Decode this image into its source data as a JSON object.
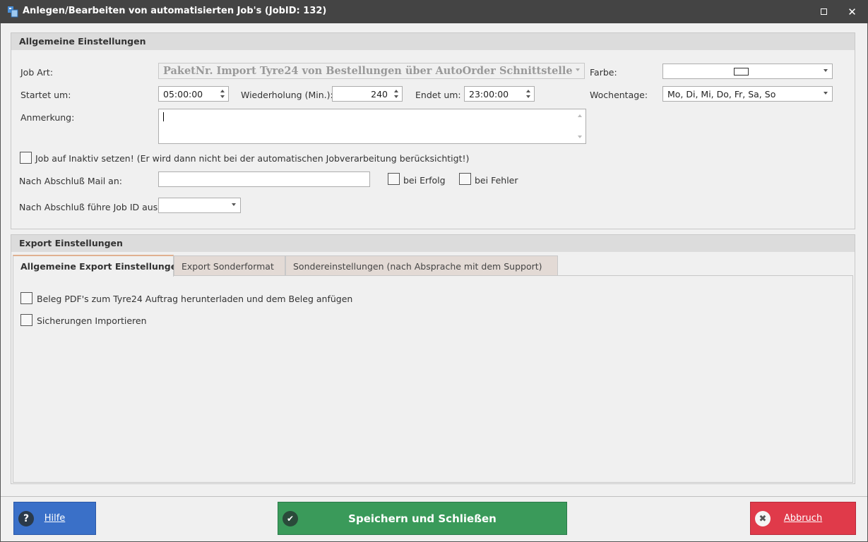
{
  "window": {
    "title": "Anlegen/Bearbeiten von automatisierten Job's (JobID: 132)",
    "icon": "app-icon"
  },
  "general": {
    "header": "Allgemeine Einstellungen",
    "job_art_label": "Job Art:",
    "job_art_value": "PaketNr. Import Tyre24 von Bestellungen über AutoOrder Schnittstelle",
    "farbe_label": "Farbe:",
    "startet_label": "Startet um:",
    "startet_value": "05:00:00",
    "wiederholung_label": "Wiederholung (Min.):",
    "wiederholung_value": "240",
    "endet_label": "Endet um:",
    "endet_value": "23:00:00",
    "wochentage_label": "Wochentage:",
    "wochentage_value": "Mo, Di, Mi, Do, Fr, Sa, So",
    "anmerkung_label": "Anmerkung:",
    "anmerkung_value": "",
    "inaktiv_label": "Job auf Inaktiv setzen! (Er wird dann nicht bei der automatischen Jobverarbeitung berücksichtigt!)",
    "mail_label": "Nach Abschluß Mail an:",
    "mail_value": "",
    "bei_erfolg_label": "bei Erfolg",
    "bei_fehler_label": "bei Fehler",
    "fuehre_label": "Nach Abschluß führe Job ID aus:",
    "fuehre_value": ""
  },
  "export": {
    "header": "Export Einstellungen",
    "tabs": [
      {
        "label": "Allgemeine Export Einstellungen",
        "active": true
      },
      {
        "label": "Export Sonderformat",
        "active": false
      },
      {
        "label": "Sondereinstellungen (nach Absprache mit dem Support)",
        "active": false
      }
    ],
    "options": [
      {
        "label": "Beleg PDF's zum Tyre24 Auftrag herunterladen und dem Beleg anfügen",
        "checked": false
      },
      {
        "label": "Sicherungen Importieren",
        "checked": false
      }
    ]
  },
  "footer": {
    "hilfe_label": "Hilfe",
    "save_label": "Speichern und Schließen",
    "abbruch_label": "Abbruch",
    "colors": {
      "hilfe": "#3a70c8",
      "save": "#3a9a5a",
      "abbruch": "#e03a4a"
    }
  }
}
